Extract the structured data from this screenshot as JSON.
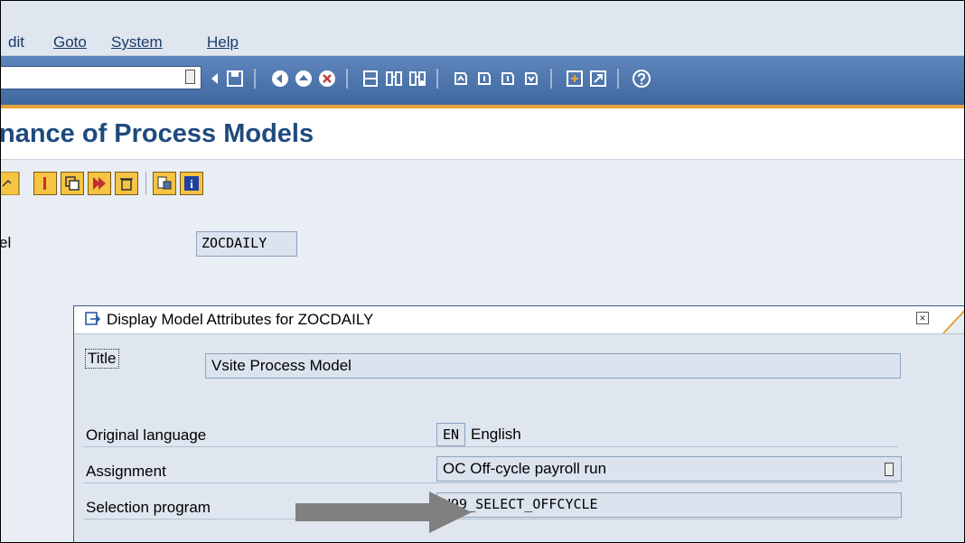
{
  "menu": {
    "items": [
      {
        "label": "dit"
      },
      {
        "label": "Goto"
      },
      {
        "label": "System"
      },
      {
        "label": "Help"
      }
    ]
  },
  "page": {
    "title": "nance of Process Models",
    "model_label": "el",
    "model_value": "ZOCDAILY"
  },
  "dialog": {
    "title": "Display Model Attributes for ZOCDAILY",
    "close_symbol": "×",
    "title_label": "Title",
    "title_value": "Vsite Process Model",
    "lang_label": "Original language",
    "lang_key": "EN",
    "lang_value": "English",
    "assign_label": "Assignment",
    "assign_value": "OC Off-cycle payroll run",
    "selprog_label": "Selection program",
    "selprog_value": "H99_SELECT_OFFCYCLE"
  },
  "colors": {
    "accent_orange": "#e6a33a",
    "toolbar_blue": "#4a73aa",
    "title_blue": "#1f4a7e",
    "arrow_gray": "#808080"
  }
}
